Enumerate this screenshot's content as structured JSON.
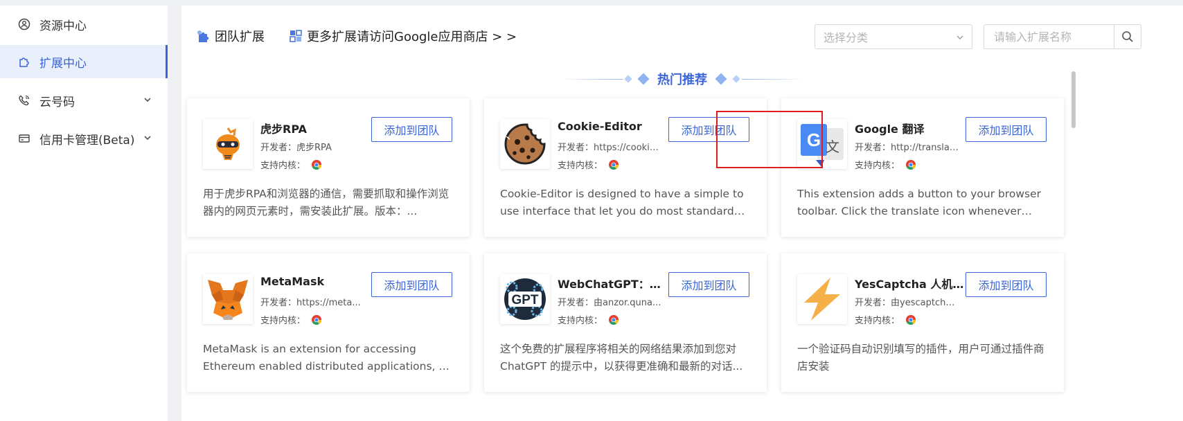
{
  "sidebar": {
    "items": [
      {
        "label": "资源中心",
        "icon": "user-circle-icon"
      },
      {
        "label": "扩展中心",
        "icon": "puzzle-icon",
        "active": true
      },
      {
        "label": "云号码",
        "icon": "phone-icon",
        "expandable": true
      },
      {
        "label": "信用卡管理(Beta)",
        "icon": "credit-card-icon",
        "expandable": true
      }
    ]
  },
  "topbar": {
    "team_ext": "团队扩展",
    "store_link": "更多扩展请访问Google应用商店 > >",
    "category_placeholder": "选择分类",
    "search_placeholder": "请输入扩展名称"
  },
  "section": {
    "title": "热门推荐"
  },
  "labels": {
    "developer_prefix": "开发者：",
    "kernel_label": "支持内核："
  },
  "cards": [
    {
      "name": "虎步RPA",
      "developer": "虎步RPA",
      "button": "添加到团队",
      "description": "用于虎步RPA和浏览器的通信，需要抓取和操作浏览器内的网页元素时，需安装此扩展。版本：..."
    },
    {
      "name": "Cookie-Editor",
      "developer": "https://cookie...",
      "button": "添加到团队",
      "description": "Cookie-Editor is designed to have a simple to use interface that let you do most standard cookie..."
    },
    {
      "name": "Google 翻译",
      "developer": "http://translat...",
      "button": "添加到团队",
      "description": "This extension adds a button to your browser toolbar. Click the translate icon whenever you..."
    },
    {
      "name": "MetaMask",
      "developer": "https://meta...",
      "button": "添加到团队",
      "description": "MetaMask is an extension for accessing Ethereum enabled distributed applications, or \"Dapps\" in..."
    },
    {
      "name": "WebChatGPT：可...",
      "developer": "由anzor.quna...",
      "button": "添加到团队",
      "description": "这个免费的扩展程序将相关的网络结果添加到您对ChatGPT 的提示中，以获得更准确和最新的对话..."
    },
    {
      "name": "YesCaptcha 人机助手",
      "developer": "由yescaptcha...",
      "button": "添加到团队",
      "description": "一个验证码自动识别填写的插件，用户可通过插件商店安装"
    }
  ],
  "colors": {
    "accent": "#3a64d8",
    "highlight": "#e01c1c"
  }
}
